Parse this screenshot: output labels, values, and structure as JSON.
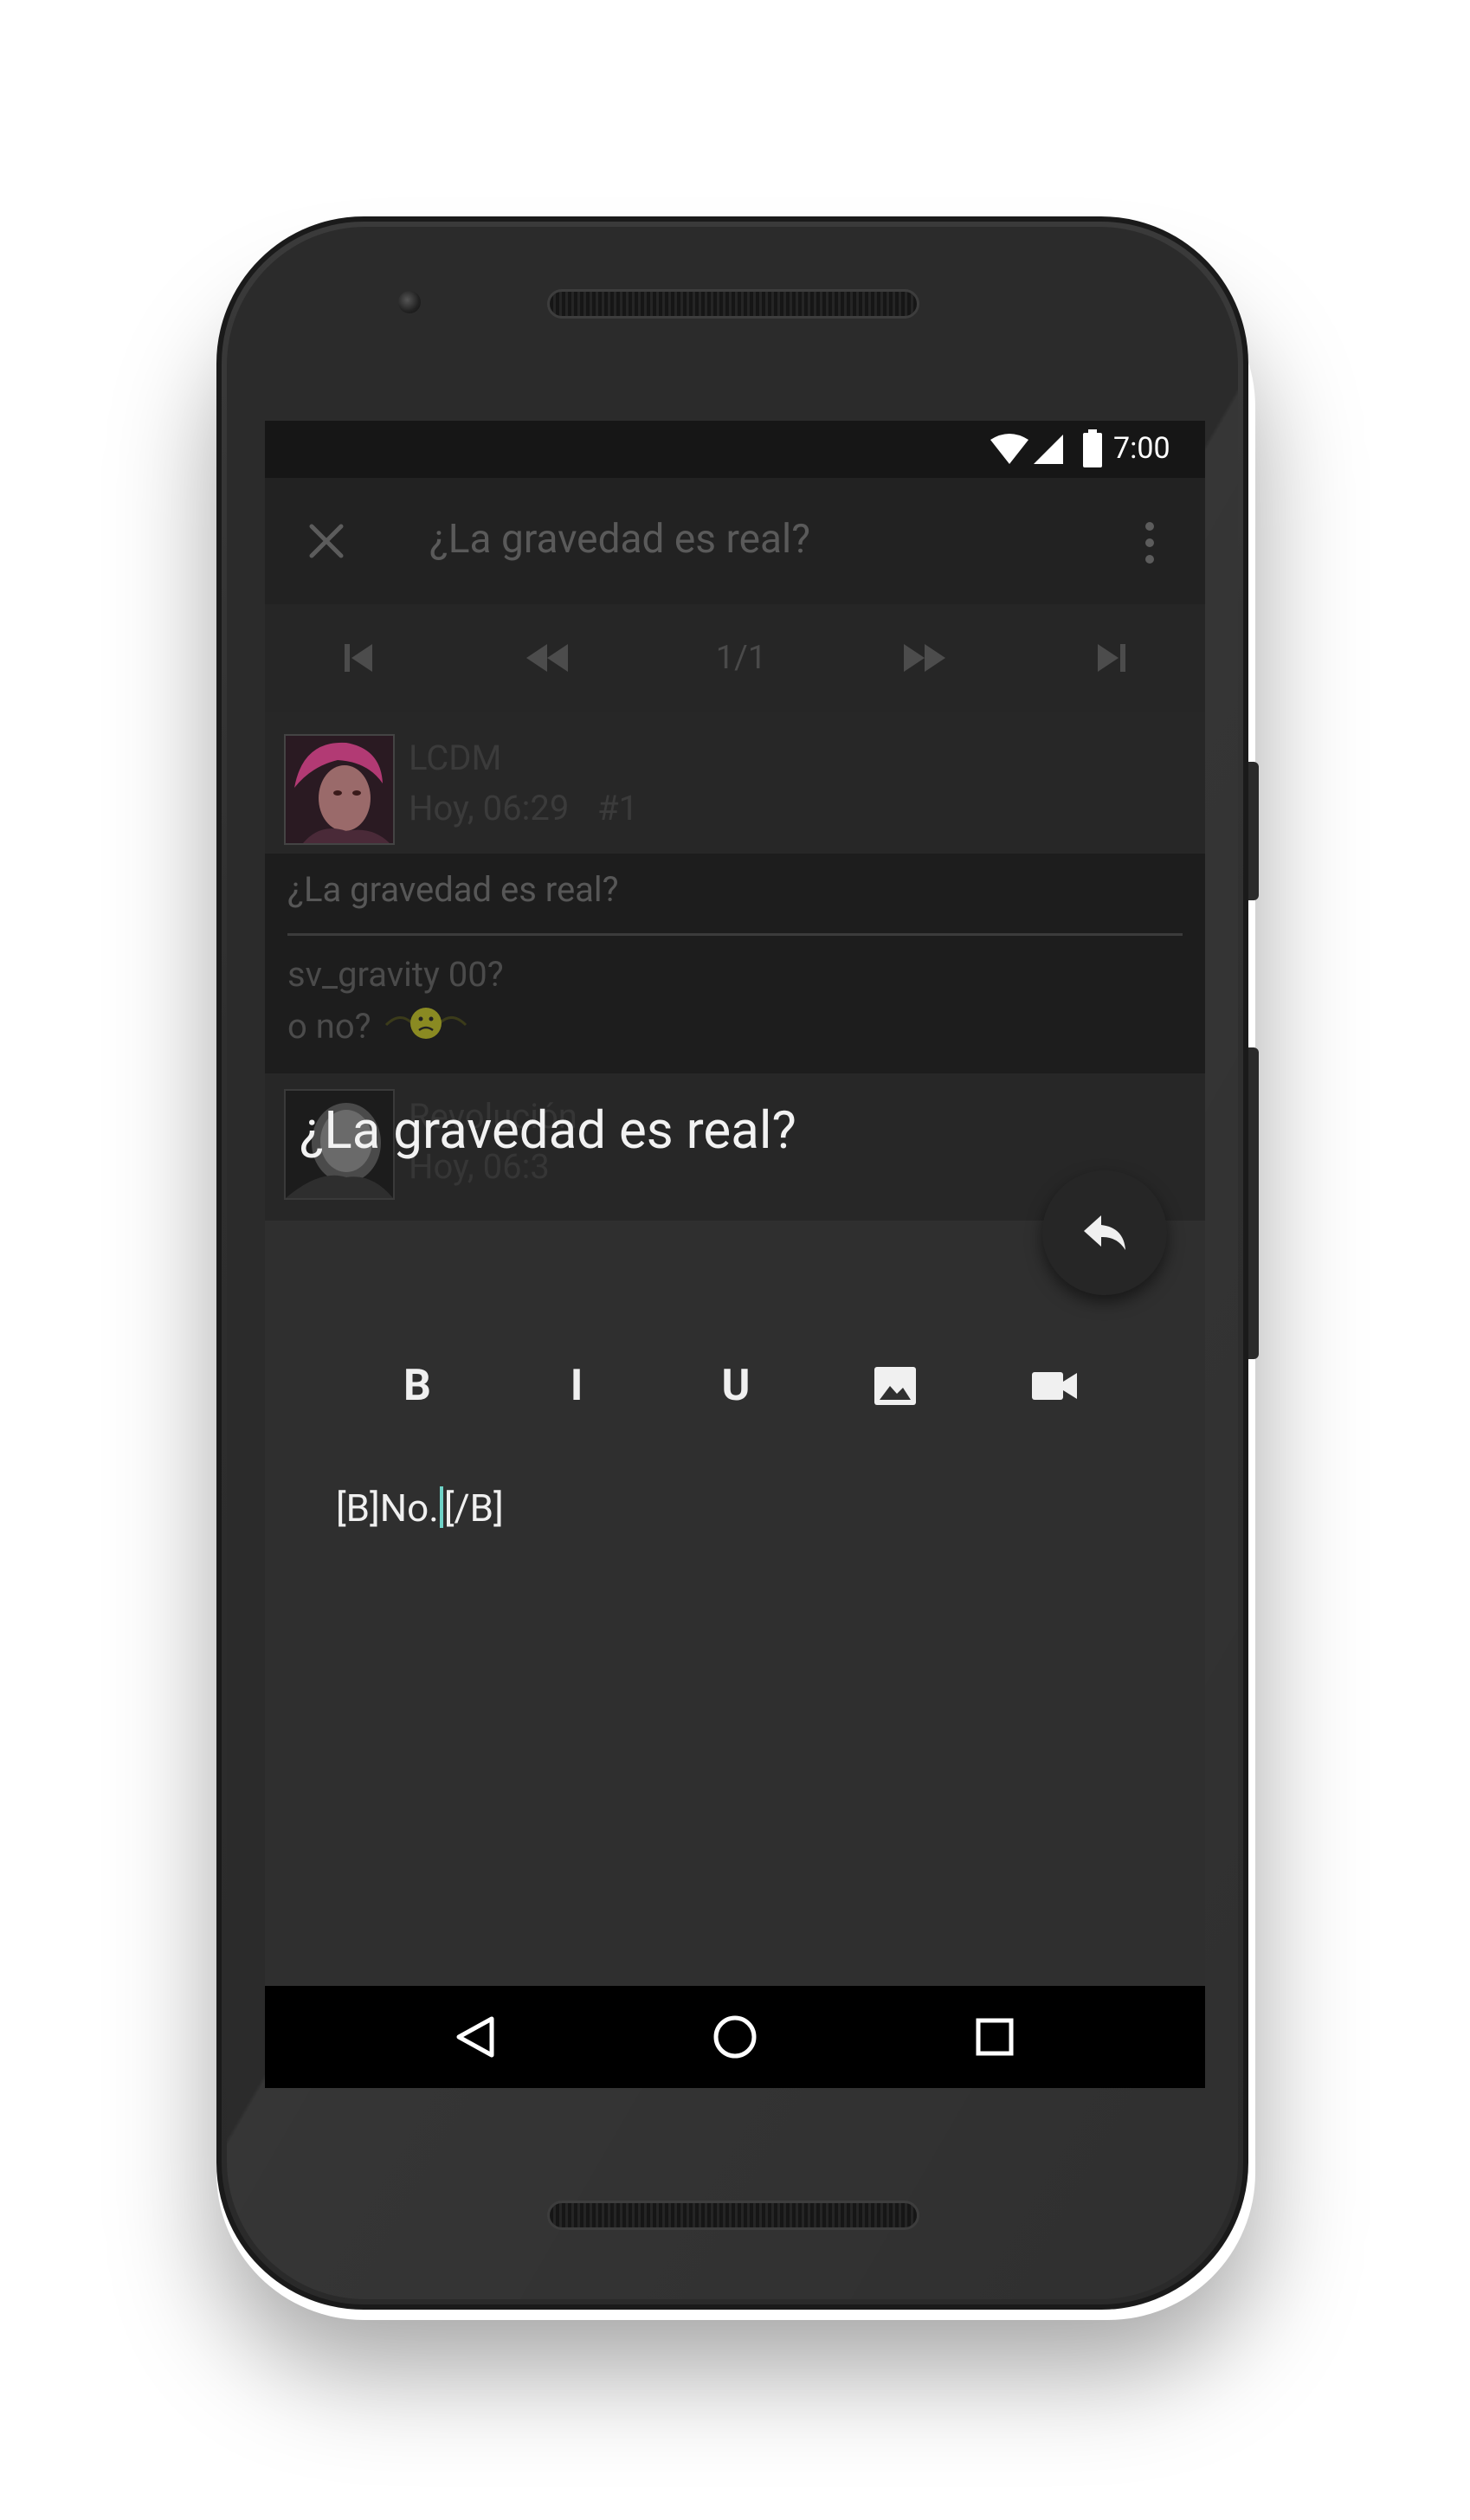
{
  "status_bar": {
    "time": "7:00"
  },
  "app_bar": {
    "title": "¿La gravedad es real?"
  },
  "navigation": {
    "page_counter": "1/1"
  },
  "posts": [
    {
      "author": "LCDM",
      "date": "Hoy, 06:29",
      "number": "#1",
      "title": "¿La gravedad es real?",
      "lines": [
        "sv_gravity 00?",
        "o no?"
      ]
    },
    {
      "author": "Revolución",
      "date": "Hoy, 06:3"
    }
  ],
  "reply": {
    "title": "¿La gravedad es real?",
    "toolbar": {
      "bold": "B",
      "italic": "I",
      "underline": "U"
    },
    "text_before_cursor": "[B]No.",
    "text_after_cursor": "[/B]"
  },
  "colors": {
    "screen_bg": "#2f2f2f",
    "status_bar": "#161616",
    "app_bar": "#222222",
    "nav_bar": "#000000",
    "cursor": "#6fd3c8"
  },
  "icons": {
    "close": "close-icon",
    "overflow": "more-vert-icon",
    "first": "skip-first-icon",
    "prev": "rewind-icon",
    "next": "fast-forward-icon",
    "last": "skip-last-icon",
    "fab": "reply-icon",
    "image": "image-icon",
    "video": "videocam-icon",
    "back": "back-triangle-icon",
    "home": "home-circle-icon",
    "recents": "recents-square-icon"
  }
}
